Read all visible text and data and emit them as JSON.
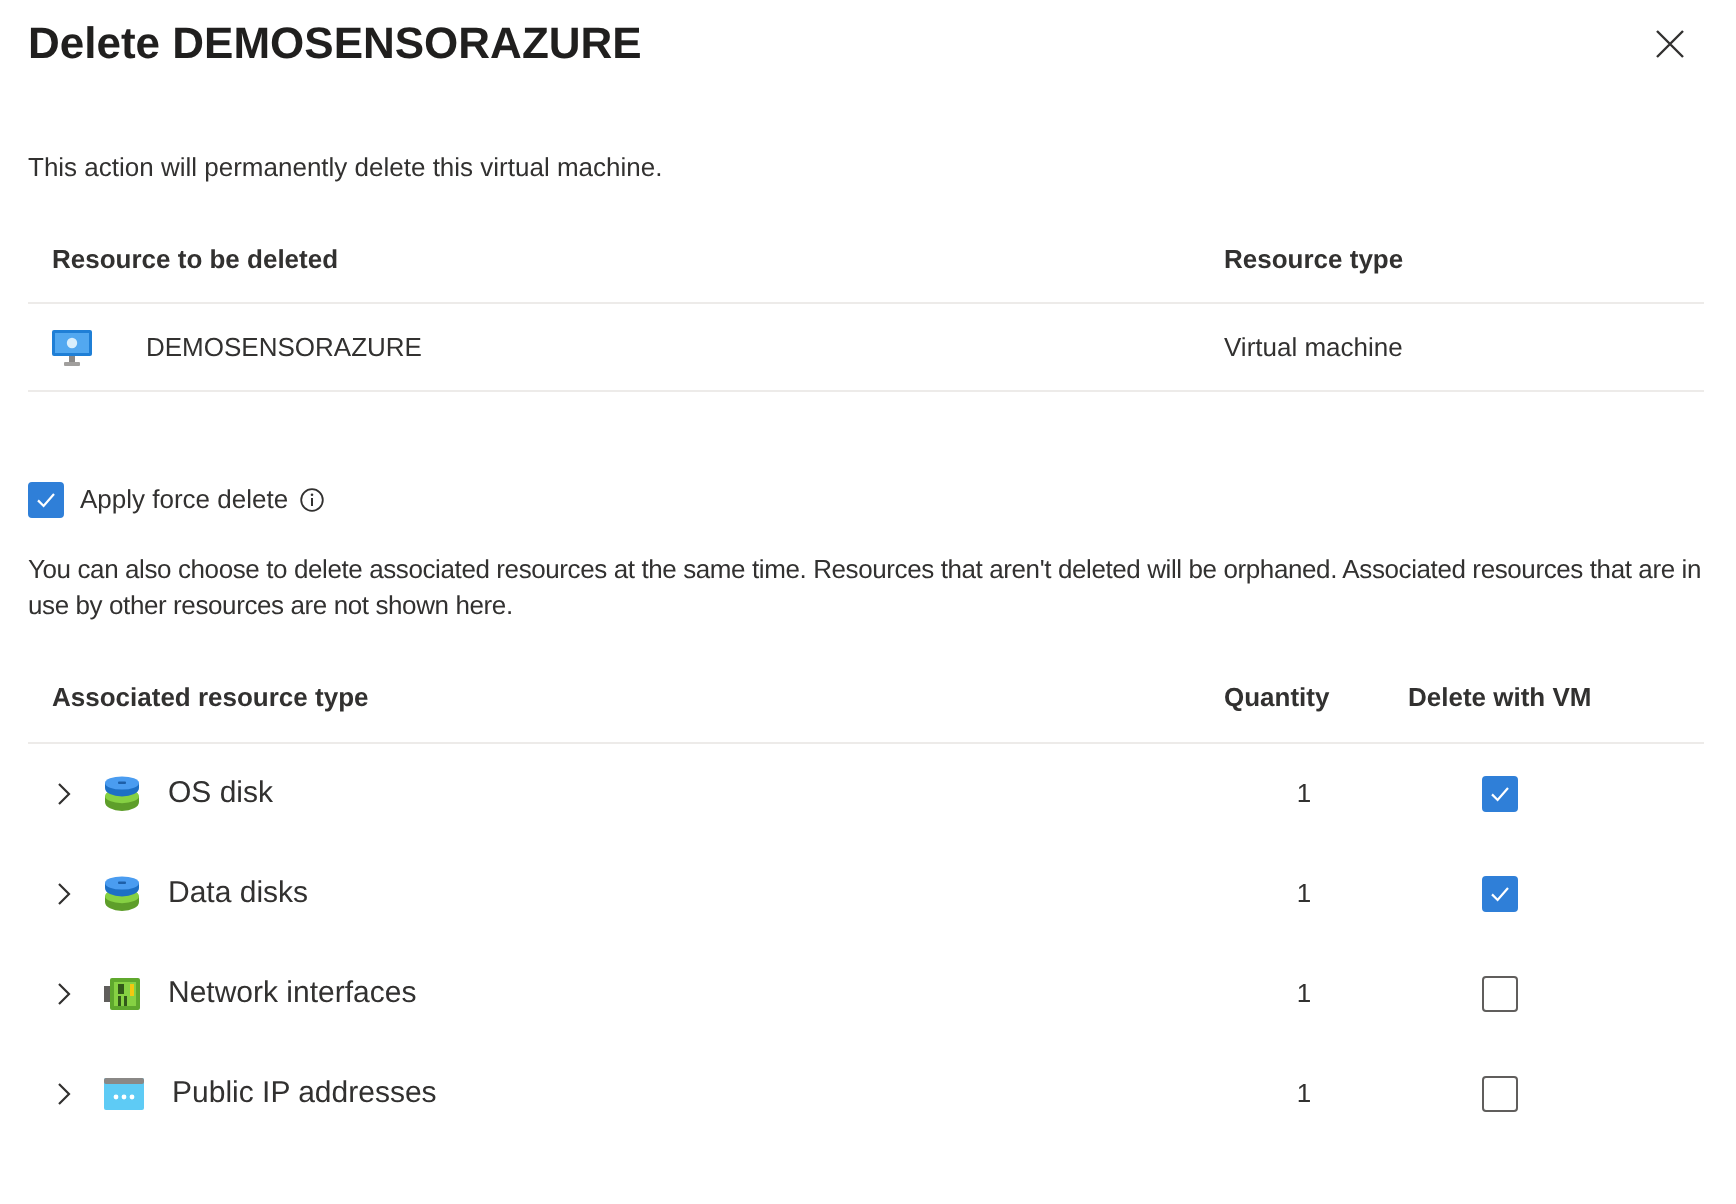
{
  "dialog": {
    "title": "Delete DEMOSENSORAZURE"
  },
  "description": "This action will permanently delete this virtual machine.",
  "resources_table": {
    "columns": [
      "Resource to be deleted",
      "Resource type"
    ],
    "rows": [
      {
        "kind": "vm",
        "name": "DEMOSENSORAZURE",
        "type": "Virtual machine"
      }
    ]
  },
  "force_delete": {
    "label": "Apply force delete",
    "checked": true
  },
  "associated_note": "You can also choose to delete associated resources at the same time. Resources that aren't deleted will be orphaned. Associated resources that are in use by other resources are not shown here.",
  "associated_table": {
    "columns": [
      "Associated resource type",
      "Quantity",
      "Delete with VM"
    ],
    "rows": [
      {
        "kind": "disk",
        "name": "OS disk",
        "quantity": "1",
        "expanded": false,
        "delete_with_vm": true
      },
      {
        "kind": "disk",
        "name": "Data disks",
        "quantity": "1",
        "expanded": false,
        "delete_with_vm": true
      },
      {
        "kind": "network-interface",
        "name": "Network interfaces",
        "quantity": "1",
        "expanded": false,
        "delete_with_vm": false
      },
      {
        "kind": "public-ip",
        "name": "Public IP addresses",
        "quantity": "1",
        "expanded": false,
        "delete_with_vm": false
      }
    ]
  }
}
